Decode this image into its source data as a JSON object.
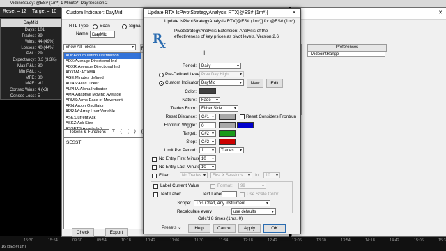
{
  "chart": {
    "title": "MidlineStudy: @ES# (1m*) 1 Minute*, Day Session 2",
    "reset_label": "Reset = 12",
    "target_label": "Target = 10",
    "stats_header": "DayMid",
    "stats": [
      {
        "k": "Days:",
        "v": "101"
      },
      {
        "k": "Trades:",
        "v": "89"
      },
      {
        "k": "Wins:",
        "v": "44 (49%)"
      },
      {
        "k": "Losses:",
        "v": "40 (44%)"
      },
      {
        "k": "P&L:",
        "v": "29"
      },
      {
        "k": "Expectancy:",
        "v": "0.3 (3.3%)"
      },
      {
        "k": "Max P&L:",
        "v": "80"
      },
      {
        "k": "Min P&L:",
        "v": "-1"
      },
      {
        "k": "MFE:",
        "v": "80"
      },
      {
        "k": "MAE:",
        "v": "-61"
      },
      {
        "k": "Consec Wins:",
        "v": "4 (x3)"
      },
      {
        "k": "Consec Loss:",
        "v": "5"
      }
    ],
    "time_ticks": [
      "15:30",
      "15:54",
      "09:30",
      "09:54",
      "10:18",
      "10:42",
      "11:06",
      "11:30",
      "11:54",
      "12:18",
      "12:42",
      "13:06",
      "13:30",
      "13:54",
      "14:18",
      "14:42",
      "15:06",
      "15:30"
    ],
    "bottom_label": "16 @ES#(1m)"
  },
  "left_dialog": {
    "title": "Custom Indicator: DayMid",
    "rtl_type_label": "RTL Type:",
    "scan_label": "Scan",
    "signal_label": "Signal",
    "name_label": "Name:",
    "name_value": "DayMid",
    "fav_label": "Fav",
    "tokens_filter": "Show All Tokens",
    "tokens": [
      "ADI:Accumulation Distribution",
      "ADX:Average Directional Ind",
      "ADXR:Average Directional Ind",
      "ADXMA:ADXMA",
      "AGE:Minutes defined",
      "ALIAS:Alias Ticker",
      "ALPHA:Alpha Indicator",
      "AMA:Adaptive Moving Average",
      "ARMS:Arms Ease of Movement",
      "ARN:Aroon Oscillator",
      "ARRAY:Array User Variable",
      "ASK:Current Ask",
      "ASKZ:Ask Size",
      "ASSETS:Assets (m)",
      "AT:Asset Turnover",
      "ATICK:Ask Tick Count"
    ],
    "tokens_functions": "-- Tokens & Functions --",
    "formula": "SESST",
    "check_label": "Check",
    "export_label": "Export"
  },
  "right_panel": {
    "preferences_header": "Preferences",
    "preferences_value": "MidpointRange"
  },
  "main_dialog": {
    "title": "Update RTX IsPivotStrategyAnalysis RTX[@ES# (1m*)]",
    "header": "Update IsPivotStrategyAnalysis RTX[@ES# (1m*)] for @ES# (1m*)",
    "description": "PivotStrategyAnalysis Extension: Analysis of the effectiveness of key prices as pivot levels. Version 2.6",
    "period_label": "Period:",
    "period_value": "Daily",
    "predefined_label": "Pre-Defined Level:",
    "predefined_value": "Prev Day High",
    "custom_label": "Custom Indicator:",
    "custom_value": "DayMid",
    "new_label": "New",
    "edit_label": "Edit",
    "color_label": "Color:",
    "nature_label": "Nature:",
    "nature_value": "Fade",
    "trades_from_label": "Trades From:",
    "trades_from_value": "Either Side",
    "reset_distance_label": "Reset Distance:",
    "reset_distance_value": "C#1",
    "reset_considers_label": "Reset Considers Frontrun",
    "frontrun_label": "Frontrun Wiggle:",
    "frontrun_value": "0",
    "target_label": "Target:",
    "target_value": "C#2",
    "stop_label": "Stop:",
    "stop_value": "C#2",
    "limit_label": "Limit Per Period:",
    "limit_value": "1",
    "limit_unit": "Trades",
    "no_entry_first_label": "No Entry First Minutes",
    "no_entry_first_value": "10",
    "no_entry_last_label": "No Entry Last Minutes",
    "no_entry_last_value": "10",
    "filter_label": "Filter:",
    "filter_value": "No Trades",
    "filter_sessions": "First X Sessions",
    "filter_in": "In",
    "filter_num": "10",
    "label_current_label": "Label Current Value",
    "format_label": "Format:",
    "format_value": "99",
    "text_label_label": "Text Label:",
    "text_label2": "Text Label:",
    "use_scale_label": "Use Scale Color",
    "scope_label": "Scope:",
    "scope_value": "This Chart, Any Instrument",
    "recalc_label": "Recalculate every",
    "recalc_value": "use defaults",
    "calcd_text": "Calc'd 8 times (1ms, 0)",
    "presets_label": "Presets",
    "help_label": "Help",
    "cancel_label": "Cancel",
    "apply_label": "Apply",
    "ok_label": "OK",
    "colors": {
      "main": "#404040",
      "reset": "#a8a8a8",
      "frontrun": "#0000cc",
      "target": "#1a9a1a",
      "stop": "#cc0000"
    }
  }
}
